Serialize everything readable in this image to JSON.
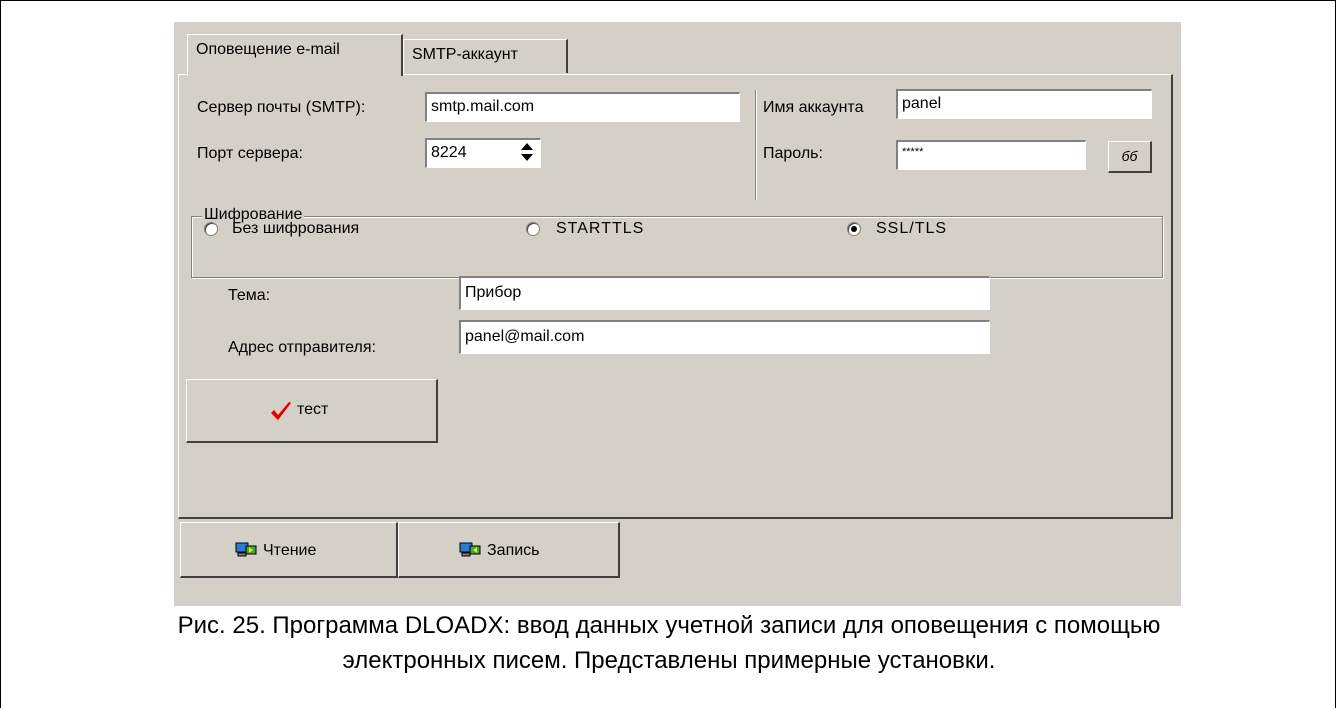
{
  "tabs": [
    {
      "label": "Оповещение e-mail",
      "active": true
    },
    {
      "label": "SMTP-аккаунт",
      "active": false
    }
  ],
  "server": {
    "label": "Сервер почты (SMTP):",
    "value": "smtp.mail.com"
  },
  "port": {
    "label": "Порт сервера:",
    "value": "8224"
  },
  "account": {
    "label": "Имя аккаунта",
    "value": "panel"
  },
  "password": {
    "label": "Пароль:",
    "value": "*****",
    "show_button": "бб"
  },
  "encryption": {
    "title": "Шифрование",
    "options": [
      {
        "label": "Без шифрования",
        "selected": false
      },
      {
        "label": "STARTTLS",
        "selected": false
      },
      {
        "label": "SSL/TLS",
        "selected": true
      }
    ]
  },
  "subject": {
    "label": "Тема:",
    "value": "Прибор"
  },
  "sender": {
    "label": "Адрес отправителя:",
    "value": "panel@mail.com"
  },
  "test_button": {
    "label": "тест",
    "icon": "checkmark-icon",
    "icon_color": "#e00000"
  },
  "bottom_buttons": [
    {
      "label": "Чтение",
      "icon": "read-computer-icon"
    },
    {
      "label": "Запись",
      "icon": "write-computer-icon"
    }
  ],
  "caption": {
    "line1": "Рис. 25. Программа DLOADX: ввод данных учетной записи для оповещения с помощью",
    "line2": "электронных писем. Представлены примерные установки."
  }
}
